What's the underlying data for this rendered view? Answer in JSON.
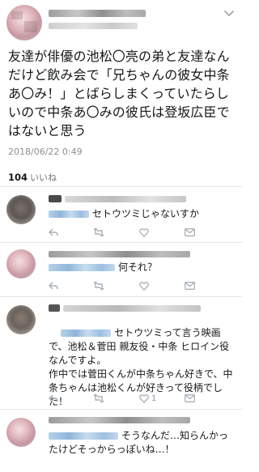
{
  "main_tweet": {
    "text": "友達が俳優の池松〇亮の弟と友達なんだけど飲み会で「兄ちゃんの彼女中条あ〇み！」とばらしまくっていたらしいので中条あ〇みの彼氏は登坂広臣ではないと思う",
    "timestamp": "2018/06/22 0:49",
    "like_count": "104",
    "like_label": "いいね"
  },
  "replies": [
    {
      "text": "セトウツミじゃないすか",
      "counts": {
        "reply": "",
        "retweet": "",
        "like": ""
      }
    },
    {
      "text": "何それ？",
      "counts": {
        "reply": "",
        "retweet": "",
        "like": ""
      }
    },
    {
      "text": "セトウツミって言う映画で、池松＆菅田 親友役・中条 ヒロイン役なんですよ。\n作中では菅田くんが中条ちゃん好きで、中条ちゃんは池松くんが好きって役柄でした！",
      "counts": {
        "reply": "",
        "retweet": "",
        "like": "1"
      }
    },
    {
      "mention": "@_______",
      "text": "そうなんだ…知らんかったけどそっからっぽいね…！"
    }
  ],
  "icons": [
    "chevron-down-icon",
    "reply-icon",
    "retweet-icon",
    "like-icon",
    "mail-icon"
  ],
  "colors": {
    "text": "#14171a",
    "muted": "#8a8f95",
    "separator": "#e1e8ed",
    "mention_blue": "#1da1f2"
  }
}
